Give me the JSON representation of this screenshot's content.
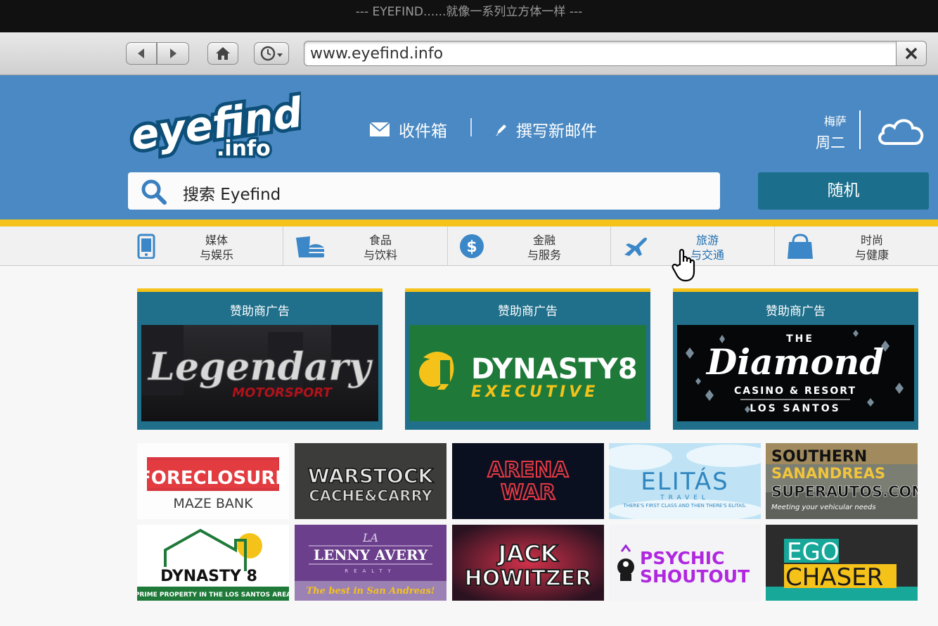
{
  "window_title": "--- EYEFIND......就像一系列立方体一样 ---",
  "browser": {
    "url": "www.eyefind.info"
  },
  "header": {
    "logo_top": "eyefind",
    "logo_bottom": ".info",
    "inbox_label": "收件箱",
    "compose_label": "撰写新邮件",
    "weather_city": "梅萨",
    "weather_day": "周二",
    "search_placeholder": "搜索 Eyefind",
    "random_label": "随机"
  },
  "categories": [
    {
      "line1": "媒体",
      "line2": "与娱乐",
      "icon": "phone-icon"
    },
    {
      "line1": "食品",
      "line2": "与饮料",
      "icon": "burger-icon"
    },
    {
      "line1": "金融",
      "line2": "与服务",
      "icon": "dollar-icon"
    },
    {
      "line1": "旅游",
      "line2": "与交通",
      "icon": "plane-icon"
    },
    {
      "line1": "时尚",
      "line2": "与健康",
      "icon": "shopping-bag-icon"
    }
  ],
  "sponsors": [
    {
      "label": "赞助商广告",
      "brand": "Legendary",
      "sub": "MOTORSPORT"
    },
    {
      "label": "赞助商广告",
      "brand": "DYNASTY8",
      "sub": "EXECUTIVE"
    },
    {
      "label": "赞助商广告",
      "brand_top": "THE",
      "brand": "Diamond",
      "sub1": "CASINO & RESORT",
      "sub2": "LOS SANTOS"
    }
  ],
  "tiles": {
    "foreclosure": {
      "top": "FORECLOSURE",
      "bottom": "MAZE BANK"
    },
    "warstock": {
      "top": "WARSTOCK",
      "bottom": "CACHE&CARRY"
    },
    "arena": {
      "top": "ARENA",
      "bottom": "WAR"
    },
    "elitas": {
      "top": "ELITÁS",
      "mid": "TRAVEL",
      "bottom": "THERE'S FIRST CLASS AND THEN THERE'S ELITAS."
    },
    "southern": {
      "l1": "SOUTHERN",
      "l2": "SANANDREAS",
      "l3": "SUPERAUTOS.COM",
      "l4": "Meeting your vehicular needs"
    },
    "dynasty": {
      "top": "DYNASTY 8",
      "bottom": "PRIME PROPERTY IN THE LOS SANTOS AREA"
    },
    "lenny": {
      "la": "LA",
      "top": "LENNY AVERY",
      "mid": "REALTY",
      "bottom": "The best in San Andreas!"
    },
    "jack": {
      "top": "JACK",
      "bottom": "HOWITZER"
    },
    "psychic": {
      "top": "PSYCHIC",
      "bottom": "SHOUTOUT"
    },
    "ego": {
      "top": "EGO",
      "bottom": "CHASER"
    }
  }
}
